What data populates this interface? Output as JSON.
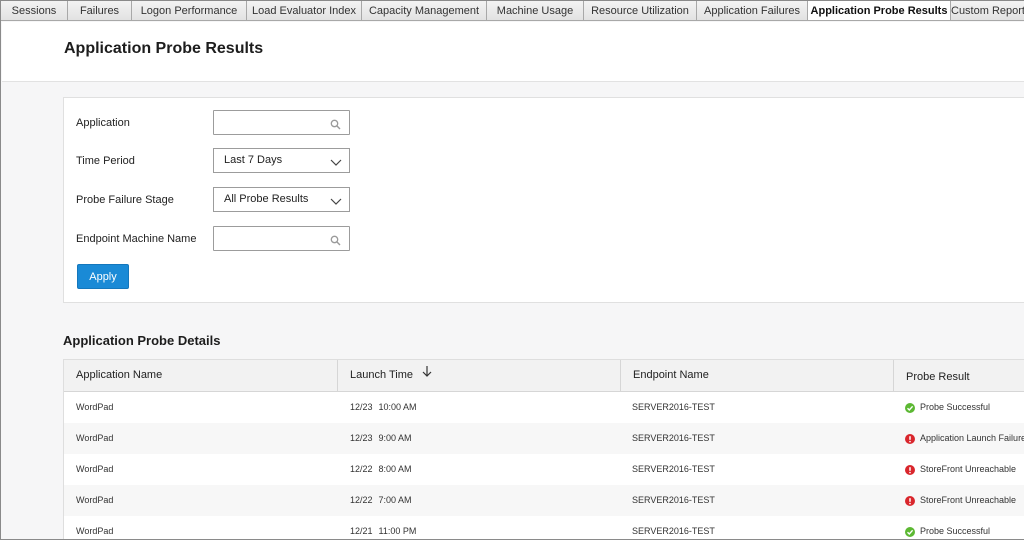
{
  "tabs": [
    {
      "label": "Sessions",
      "active": false,
      "w": 67
    },
    {
      "label": "Failures",
      "active": false,
      "w": 64
    },
    {
      "label": "Logon Performance",
      "active": false,
      "w": 115
    },
    {
      "label": "Load Evaluator Index",
      "active": false,
      "w": 115
    },
    {
      "label": "Capacity Management",
      "active": false,
      "w": 125
    },
    {
      "label": "Machine Usage",
      "active": false,
      "w": 97
    },
    {
      "label": "Resource Utilization",
      "active": false,
      "w": 113
    },
    {
      "label": "Application Failures",
      "active": false,
      "w": 111
    },
    {
      "label": "Application Probe Results",
      "active": true,
      "w": 143
    },
    {
      "label": "Custom Reports",
      "active": false,
      "w": 74
    }
  ],
  "page": {
    "title": "Application Probe Results"
  },
  "filters": {
    "application_label": "Application",
    "time_period_label": "Time Period",
    "time_period_value": "Last 7 Days",
    "failure_stage_label": "Probe Failure Stage",
    "failure_stage_value": "All Probe Results",
    "endpoint_label": "Endpoint Machine Name",
    "apply_label": "Apply"
  },
  "details": {
    "title": "Application Probe Details",
    "columns": {
      "app_name": "Application Name",
      "launch_time": "Launch Time",
      "endpoint": "Endpoint Name",
      "result": "Probe Result"
    },
    "rows": [
      {
        "app": "WordPad",
        "date": "12/23",
        "time": "10:00 AM",
        "endpoint": "SERVER2016-TEST",
        "result": "Probe Successful",
        "status": "success"
      },
      {
        "app": "WordPad",
        "date": "12/23",
        "time": "9:00 AM",
        "endpoint": "SERVER2016-TEST",
        "result": "Application Launch Failure",
        "status": "error"
      },
      {
        "app": "WordPad",
        "date": "12/22",
        "time": "8:00 AM",
        "endpoint": "SERVER2016-TEST",
        "result": "StoreFront Unreachable",
        "status": "error"
      },
      {
        "app": "WordPad",
        "date": "12/22",
        "time": "7:00 AM",
        "endpoint": "SERVER2016-TEST",
        "result": "StoreFront Unreachable",
        "status": "error"
      },
      {
        "app": "WordPad",
        "date": "12/21",
        "time": "11:00 PM",
        "endpoint": "SERVER2016-TEST",
        "result": "Probe Successful",
        "status": "success"
      }
    ]
  },
  "colors": {
    "success": "#5cb833",
    "error": "#d9262c",
    "accent": "#1a8ad6"
  },
  "icons": {
    "search": "search-icon",
    "dropdown": "chevron-down-icon",
    "sort": "arrow-down-icon"
  }
}
